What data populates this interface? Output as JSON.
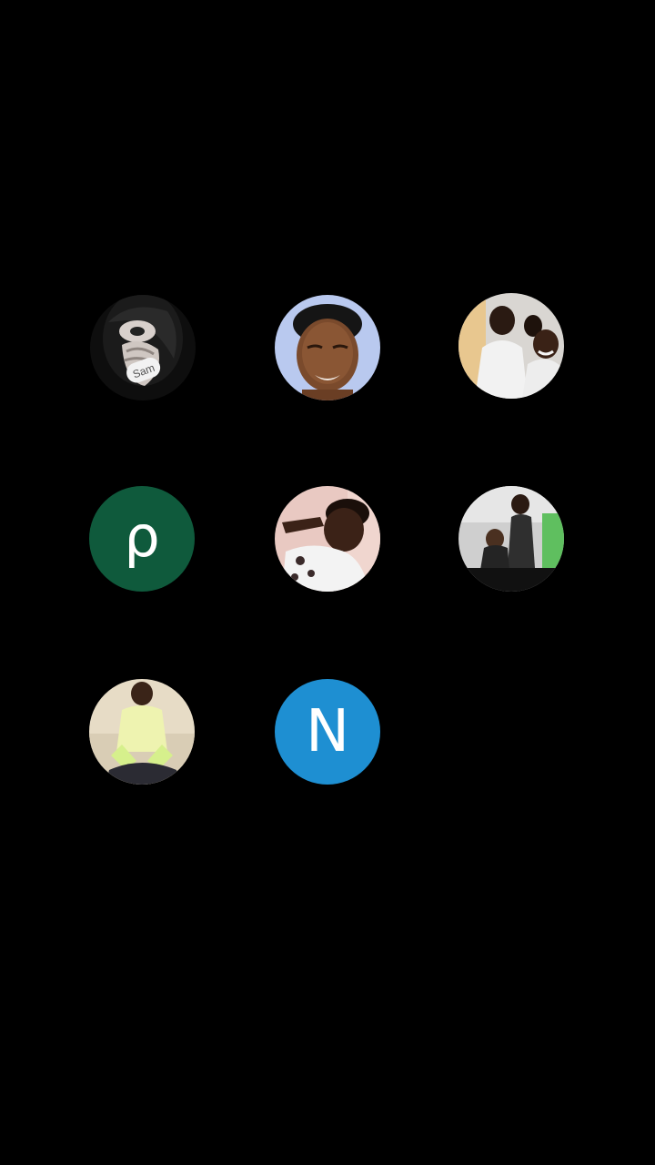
{
  "contacts": [
    {
      "type": "photo",
      "name_label": "Sam"
    },
    {
      "type": "photo"
    },
    {
      "type": "photo"
    },
    {
      "type": "letter",
      "letter": "ρ",
      "color": "#0f5a3c"
    },
    {
      "type": "photo"
    },
    {
      "type": "photo"
    },
    {
      "type": "photo"
    },
    {
      "type": "letter",
      "letter": "N",
      "color": "#1e8fd2"
    }
  ]
}
